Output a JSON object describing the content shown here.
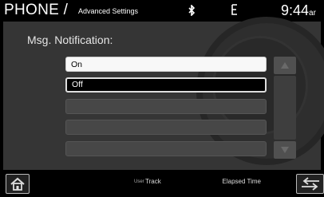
{
  "header": {
    "title": "PHONE /",
    "subtitle": "Advanced Settings",
    "bluetooth_icon": "bluetooth-icon",
    "phone_icon": "phone-signal-icon",
    "time": "9:44",
    "ampm": "ar"
  },
  "panel": {
    "heading": "Msg. Notification:",
    "options": [
      {
        "label": "On",
        "selected": false
      },
      {
        "label": "Off",
        "selected": true
      }
    ],
    "empty_rows": 3
  },
  "footer": {
    "user_label": "User",
    "track_label": "Track",
    "elapsed_label": "Elapsed Time"
  },
  "colors": {
    "panel": "#353535",
    "option_highlight": "#f8f8f8",
    "selected_bg": "#000000"
  }
}
